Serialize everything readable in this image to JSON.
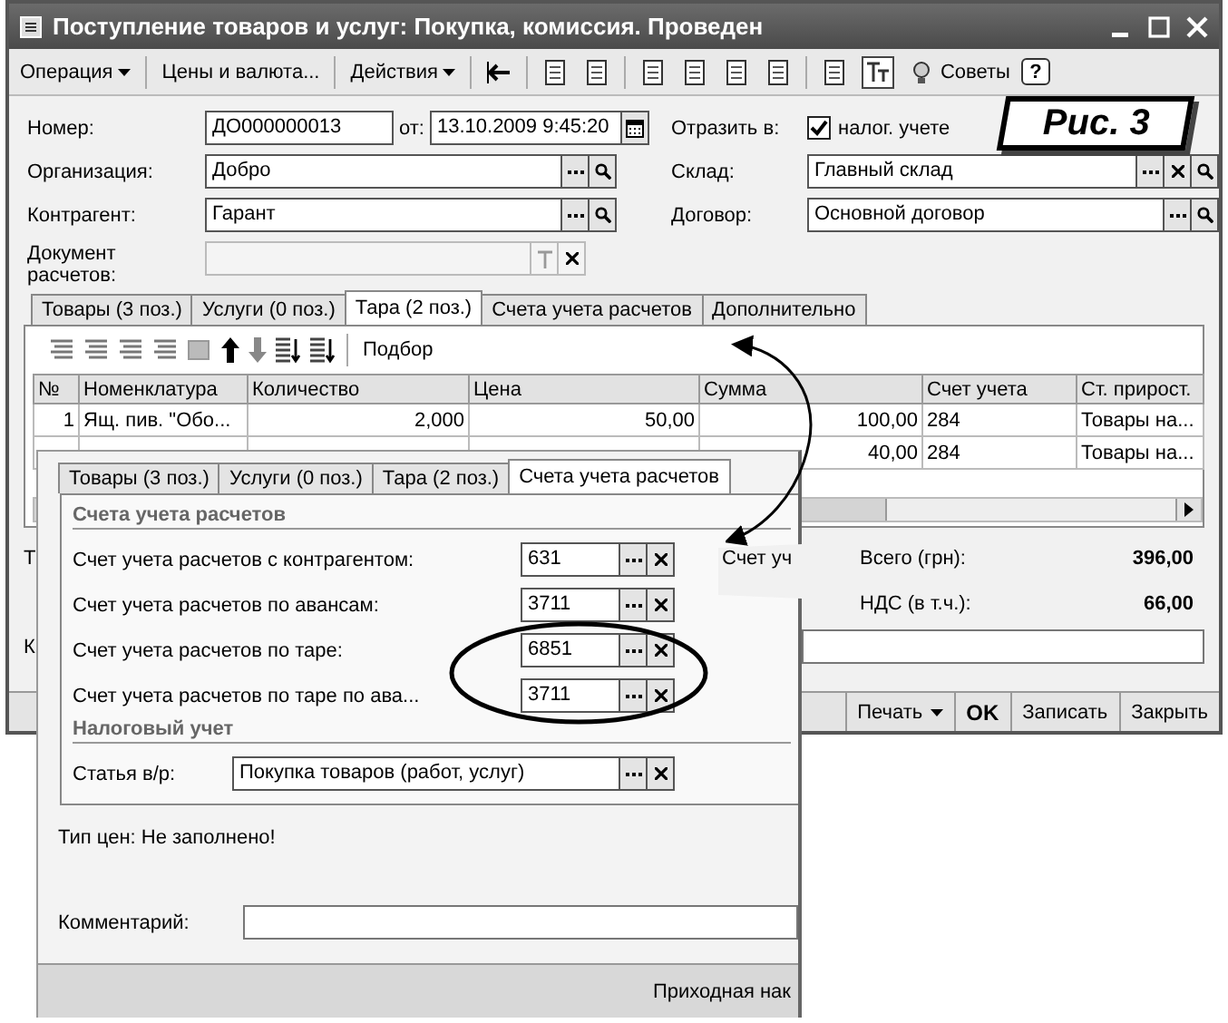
{
  "window": {
    "title": "Поступление товаров и услуг: Покупка, комиссия. Проведен"
  },
  "toolbar": [
    {
      "label": "Операция",
      "dropdown": true
    },
    {
      "label": "Цены и валюта...",
      "dropdown": false
    },
    {
      "label": "Действия",
      "dropdown": true
    }
  ],
  "tips": {
    "label": "Советы",
    "help": "?"
  },
  "figure_label": "Рис. 3",
  "form": [
    {
      "kind": "number",
      "label": "Номер:",
      "value": "ДО000000013",
      "date_label": "от:",
      "date": "13.10.2009  9:45:20"
    },
    {
      "kind": "checkbox",
      "label": "Отразить в:",
      "option": "налог. учете",
      "checked": true
    },
    {
      "kind": "ref",
      "label": "Организация:",
      "value": "Добро",
      "clear": false
    },
    {
      "kind": "ref",
      "label": "Склад:",
      "value": "Главный склад",
      "clear": true
    },
    {
      "kind": "ref",
      "label": "Контрагент:",
      "value": "Гарант",
      "clear": false
    },
    {
      "kind": "ref",
      "label": "Договор:",
      "value": "Основной договор",
      "clear": false
    },
    {
      "kind": "doc",
      "label": "Документ расчетов:",
      "disabled": true
    }
  ],
  "tabs": [
    {
      "label": "Товары (3 поз.)",
      "selected": false
    },
    {
      "label": "Услуги (0 поз.)",
      "selected": false
    },
    {
      "label": "Тара (2 поз.)",
      "selected": true
    },
    {
      "label": "Счета учета расчетов",
      "selected": false
    },
    {
      "label": "Дополнительно",
      "selected": false
    }
  ],
  "table_toolbar": {
    "label": "Подбор"
  },
  "table": {
    "columns": [
      "№",
      "Номенклатура",
      "Количество",
      "Цена",
      "Сумма",
      "Счет учета",
      "Ст. прирост."
    ],
    "rows": [
      {
        "cells": [
          "1",
          "Ящ. пив. \"Обо...",
          "2,000",
          "50,00",
          "100,00",
          "284",
          "Товары на..."
        ]
      },
      {
        "cells": [
          "",
          "",
          "",
          "",
          "40,00",
          "284",
          "Товары на..."
        ]
      }
    ]
  },
  "cut_labels": {
    "left_top": "Т",
    "left_bottom": "К",
    "middle": "Счет уч"
  },
  "totals": [
    {
      "label": "Всего (грн):",
      "value": "396,00"
    },
    {
      "label": "НДС (в т.ч.):",
      "value": "66,00"
    }
  ],
  "buttons": [
    {
      "label": "Печать",
      "dropdown": true,
      "default": false
    },
    {
      "label": "OK",
      "dropdown": false,
      "default": true
    },
    {
      "label": "Записать",
      "dropdown": false,
      "default": false
    },
    {
      "label": "Закрыть",
      "dropdown": false,
      "default": false
    }
  ],
  "overlay": {
    "tabs": [
      {
        "label": "Товары (3 поз.)",
        "selected": false
      },
      {
        "label": "Услуги (0 поз.)",
        "selected": false
      },
      {
        "label": "Тара (2 поз.)",
        "selected": false
      },
      {
        "label": "Счета учета расчетов",
        "selected": true
      }
    ],
    "group_title": "Счета учета расчетов",
    "accounts": [
      {
        "label": "Счет учета расчетов с контрагентом:",
        "value": "631"
      },
      {
        "label": "Счет учета расчетов по авансам:",
        "value": "3711"
      },
      {
        "label": "Счет учета расчетов по таре:",
        "value": "6851"
      },
      {
        "label": "Счет учета расчетов по таре по ава...",
        "value": "3711"
      }
    ],
    "tax_title": "Налоговый учет",
    "tax_field": {
      "label": "Статья в/р:",
      "value": "Покупка товаров (работ, услуг)"
    },
    "price_type": "Тип цен: Не заполнено!",
    "comment_label": "Комментарий:",
    "status": "Приходная нак"
  }
}
